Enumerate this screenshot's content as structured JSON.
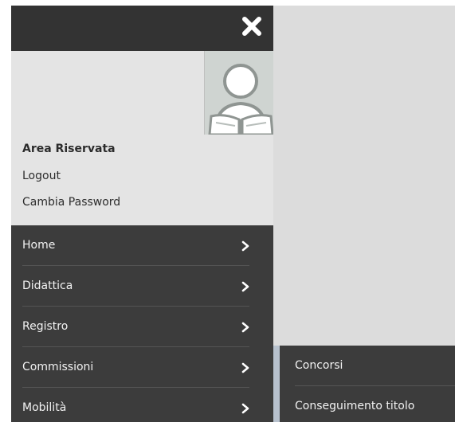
{
  "colors": {
    "header_bg": "#333333",
    "menu_bg": "#3c3c3c",
    "panel_bg": "#e4e4e4",
    "backdrop": "#dcdcdc",
    "submenu_accent": "#b7c1cd"
  },
  "header": {
    "close_icon": "close-x-icon"
  },
  "user": {
    "avatar_icon": "user-reading-avatar",
    "area_label": "Area Riservata",
    "logout_label": "Logout",
    "change_password_label": "Cambia Password"
  },
  "menu": {
    "items": [
      {
        "label": "Home",
        "icon": "chevron-right-icon"
      },
      {
        "label": "Didattica",
        "icon": "chevron-right-icon"
      },
      {
        "label": "Registro",
        "icon": "chevron-right-icon"
      },
      {
        "label": "Commissioni",
        "icon": "chevron-right-icon"
      },
      {
        "label": "Mobilità",
        "icon": "chevron-right-icon"
      }
    ]
  },
  "submenu": {
    "items": [
      {
        "label": "Concorsi"
      },
      {
        "label": "Conseguimento titolo"
      }
    ]
  }
}
